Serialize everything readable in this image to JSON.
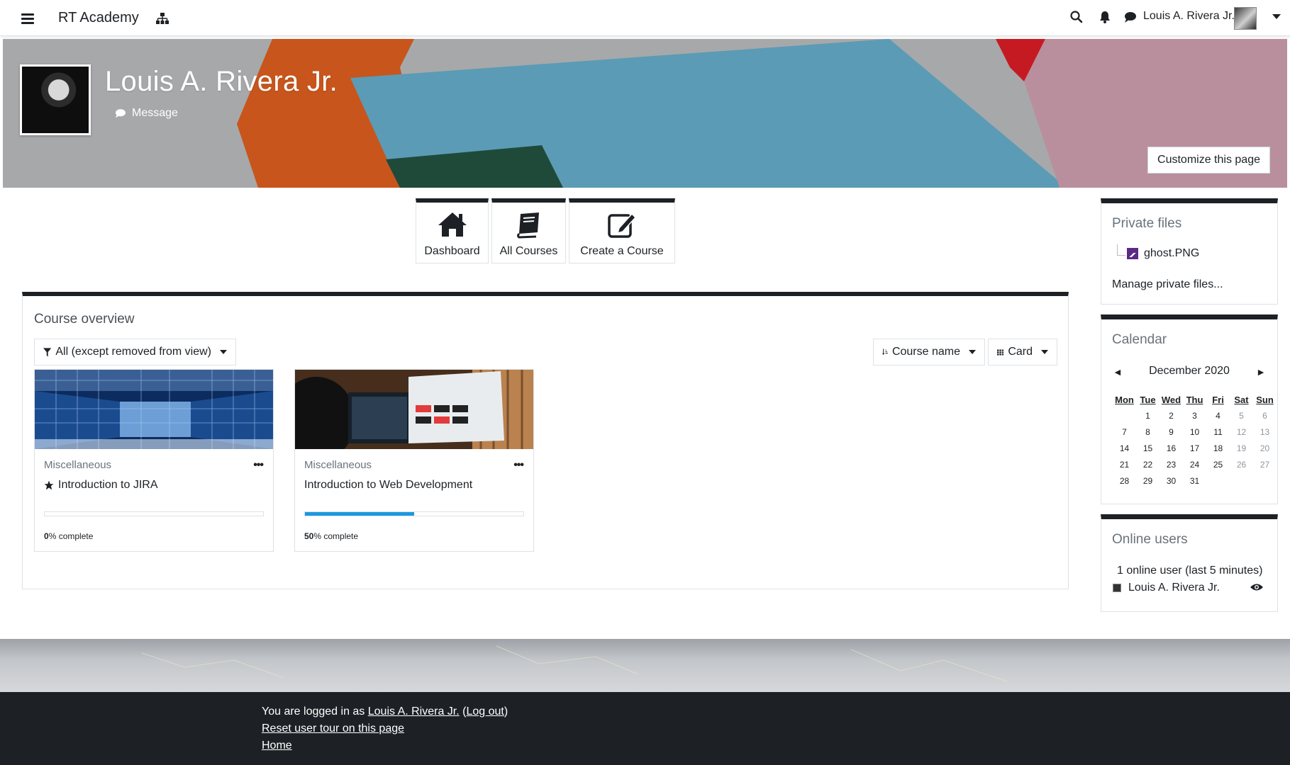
{
  "navbar": {
    "brand": "RT Academy",
    "user_name": "Louis A. Rivera Jr."
  },
  "header": {
    "name": "Louis A. Rivera Jr.",
    "message_label": "Message",
    "customize_label": "Customize this page"
  },
  "quicklinks": [
    {
      "label": "Dashboard",
      "icon": "home-icon"
    },
    {
      "label": "All Courses",
      "icon": "book-icon"
    },
    {
      "label": "Create a Course",
      "icon": "edit-icon"
    }
  ],
  "overview": {
    "title": "Course overview",
    "filter_label": "All (except removed from view)",
    "sort_label": "Course name",
    "view_label": "Card",
    "courses": [
      {
        "category": "Miscellaneous",
        "name": "Introduction to JIRA",
        "starred": true,
        "progress_value": "0",
        "progress_suffix": "% complete",
        "progress_fraction": 0
      },
      {
        "category": "Miscellaneous",
        "name": "Introduction to Web Development",
        "starred": false,
        "progress_value": "50",
        "progress_suffix": "% complete",
        "progress_fraction": 0.5
      }
    ]
  },
  "private_files": {
    "title": "Private files",
    "file_name": "ghost.PNG",
    "manage_label": "Manage private files..."
  },
  "calendar": {
    "title": "Calendar",
    "month": "December 2020",
    "prev": "◄",
    "next": "►",
    "weekdays": [
      "Mon",
      "Tue",
      "Wed",
      "Thu",
      "Fri",
      "Sat",
      "Sun"
    ],
    "weeks": [
      [
        "",
        "1",
        "2",
        "3",
        "4",
        "5",
        "6"
      ],
      [
        "7",
        "8",
        "9",
        "10",
        "11",
        "12",
        "13"
      ],
      [
        "14",
        "15",
        "16",
        "17",
        "18",
        "19",
        "20"
      ],
      [
        "21",
        "22",
        "23",
        "24",
        "25",
        "26",
        "27"
      ],
      [
        "28",
        "29",
        "30",
        "31",
        "",
        "",
        ""
      ]
    ]
  },
  "online_users": {
    "title": "Online users",
    "count_text": "1 online user (last 5 minutes)",
    "user": "Louis A. Rivera Jr."
  },
  "footer": {
    "logged_in_prefix": "You are logged in as ",
    "user_link": "Louis A. Rivera Jr.",
    "open_paren": " (",
    "logout": "Log out",
    "close_paren": ")",
    "reset_tour": "Reset user tour on this page",
    "home": "Home"
  },
  "colors": {
    "accent": "#1b98e0",
    "dark": "#1d2125"
  }
}
